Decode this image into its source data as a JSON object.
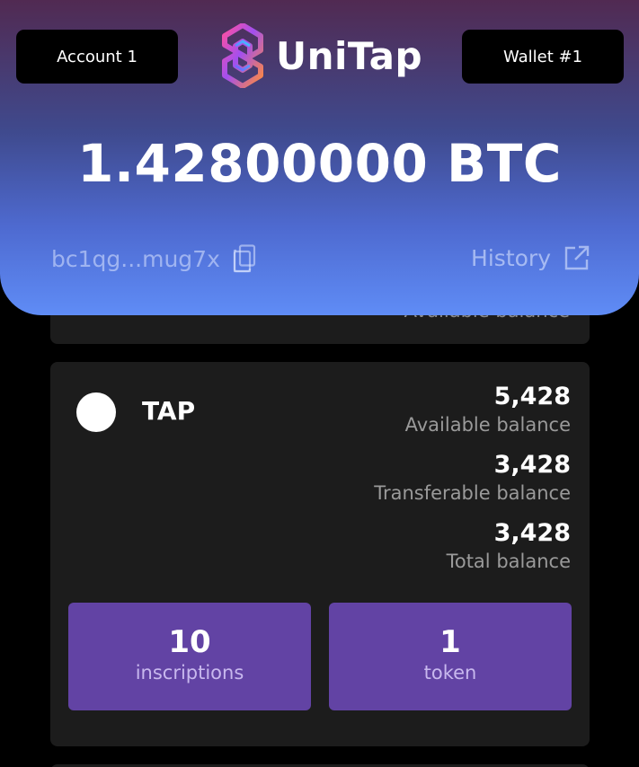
{
  "header": {
    "account_label": "Account 1",
    "wallet_label": "Wallet #1",
    "logo_text": "UniTap",
    "balance": "1.42800000 BTC",
    "address": "bc1qg...mug7x",
    "history_label": "History"
  },
  "top_card": {
    "label": "Available balance"
  },
  "token_card": {
    "name": "TAP",
    "stats": [
      {
        "value": "5,428",
        "label": "Available balance"
      },
      {
        "value": "3,428",
        "label": "Transferable balance"
      },
      {
        "value": "3,428",
        "label": "Total balance"
      }
    ],
    "inscriptions": {
      "count": "10",
      "label": "inscriptions"
    },
    "tokens": {
      "count": "1",
      "label": "token"
    }
  },
  "colors": {
    "accent_button": "#6243a4",
    "card_bg": "#1c1c1c",
    "header_gradient_top": "#512a52",
    "header_gradient_bottom": "#5f8cf6"
  }
}
